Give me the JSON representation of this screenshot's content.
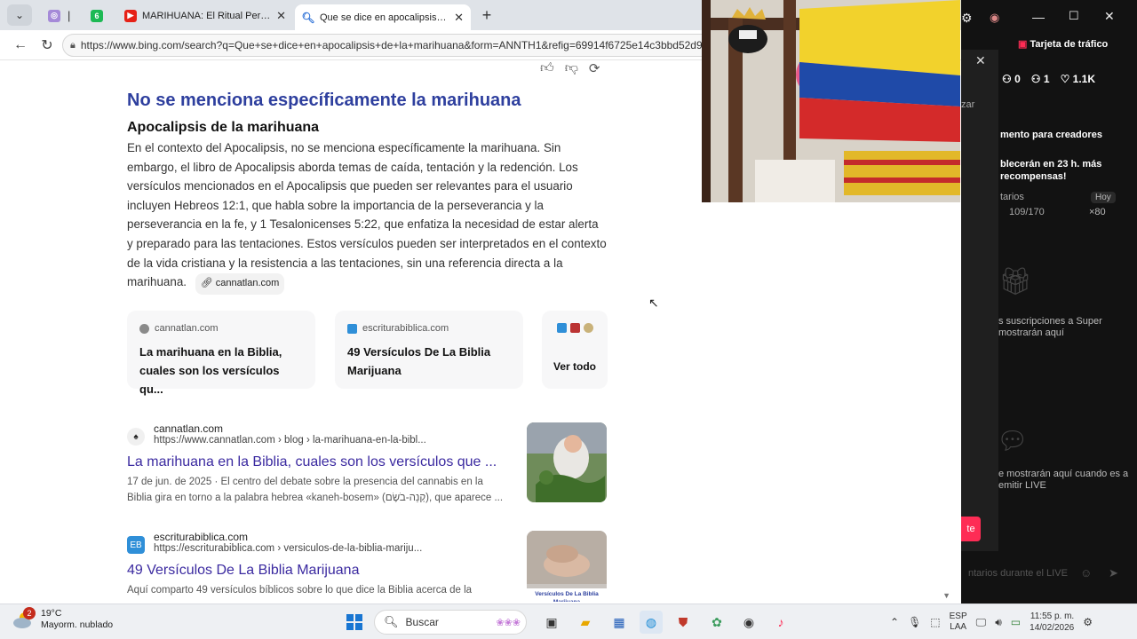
{
  "browser": {
    "tabs": [
      {
        "label": "",
        "icon": "app-icon"
      },
      {
        "label": "",
        "icon": "green-6-icon"
      },
      {
        "label": "MARIHUANA: El Ritual Perdido y el",
        "icon": "youtube-icon"
      },
      {
        "label": "Que se dice en apocalipsis de la m",
        "icon": "bing-search-icon",
        "active": true
      }
    ],
    "address": "https://www.bing.com/search?q=Que+se+dice+en+apocalipsis+de+la+marihuana&form=ANNTH1&refig=69914f6725e14c3bbd52d9"
  },
  "answer": {
    "heading": "No se menciona específicamente la marihuana",
    "subheading": "Apocalipsis de la marihuana",
    "body": "En el contexto del Apocalipsis, no se menciona específicamente la marihuana. Sin embargo, el libro de Apocalipsis aborda temas de caída, tentación y la redención. Los versículos mencionados en el Apocalipsis que pueden ser relevantes para el usuario incluyen Hebreos 12:1, que habla sobre la importancia de la perseverancia y la perseverancia en la fe, y 1 Tesalonicenses 5:22, que enfatiza la necesidad de estar alerta y preparado para las tentaciones. Estos versículos pueden ser interpretados en el contexto de la vida cristiana y la resistencia a las tentaciones, sin una referencia directa a la marihuana.",
    "source": "cannatlan.com"
  },
  "cards": [
    {
      "domain": "cannatlan.com",
      "title": "La marihuana en la Biblia, cuales son los versículos qu..."
    },
    {
      "domain": "escriturabiblica.com",
      "title": "49 Versículos De La Biblia Marijuana"
    },
    {
      "title": "Ver todo"
    }
  ],
  "results": [
    {
      "site": "cannatlan.com",
      "url": "https://www.cannatlan.com › blog › la-marihuana-en-la-bibl...",
      "title": "La marihuana en la Biblia, cuales son los versículos que ...",
      "snippet": "17 de jun. de 2025 · El centro del debate sobre la presencia del cannabis en la Biblia gira en torno a la palabra hebrea «kaneh-bosem» (קְנֵה-בֹשֶׂם), que aparece ..."
    },
    {
      "site": "escriturabiblica.com",
      "url": "https://escriturabiblica.com › versiculos-de-la-biblia-mariju...",
      "title": "49 Versículos De La Biblia Marijuana",
      "snippet": "Aquí comparto 49 versículos bíblicos sobre lo que dice la Biblia acerca de la",
      "thumb_caption": "Versículos De La Biblia Marijuana"
    }
  ],
  "tiktok": {
    "traffic_card": "Tarjeta de tráfico",
    "stats": [
      "0",
      "1",
      "1.1K"
    ],
    "side_text": "zar",
    "creators": "mento para creadores",
    "rewards": "blecerán en 23 h. más recompensas!",
    "comments_label": "tarios",
    "counter": "109/170",
    "today": "Hoy",
    "gems": "×80",
    "subs_empty": "s suscripciones a Super mostrarán aquí",
    "live_empty": "e mostrarán aquí cuando es a emitir LIVE",
    "go_live": "te",
    "comment_placeholder": "ntarios durante el LIVE"
  },
  "taskbar": {
    "temp": "19°C",
    "weather": "Mayorm. nublado",
    "notif_count": "2",
    "search_placeholder": "Buscar",
    "lang1": "ESP",
    "lang2": "LAA",
    "time": "11:55 p. m.",
    "date": "14/02/2026"
  }
}
